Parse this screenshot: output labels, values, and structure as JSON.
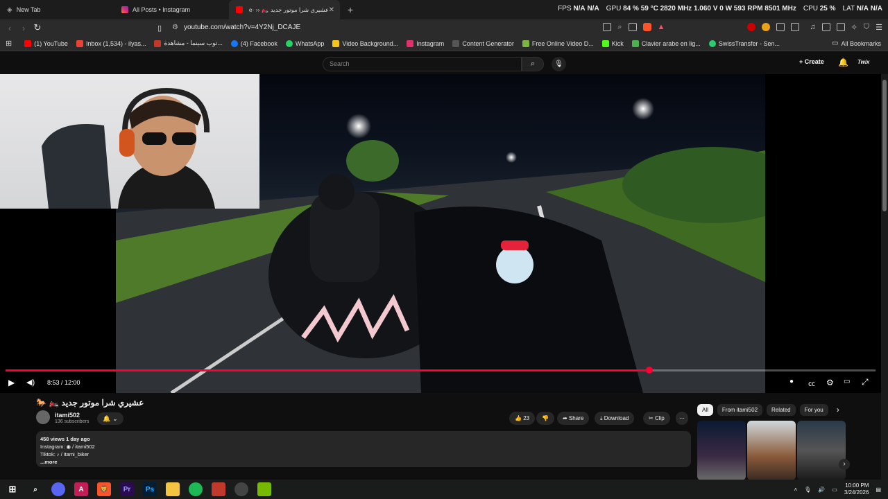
{
  "tabs": [
    {
      "title": "New Tab",
      "icon": "new-tab-icon"
    },
    {
      "title": "All Posts • Instagram",
      "icon": "instagram-icon"
    },
    {
      "title": "عشيري شرا موتور جديد 🏍️ ‹‹ ·e",
      "icon": "youtube-icon",
      "active": true
    }
  ],
  "hud": {
    "fps_label": "FPS",
    "fps1": "N/A",
    "fps2": "N/A",
    "gpu_label": "GPU",
    "gpu_load": "84 %",
    "gpu_temp": "59 °C",
    "gpu_clock": "2820 MHz",
    "gpu_volt": "1.060 V",
    "gpu_power": "0 W",
    "gpu_fan": "593 RPM",
    "gpu_mem": "8501 MHz",
    "cpu_label": "CPU",
    "cpu_load": "25 %",
    "lat_label": "LAT",
    "lat1": "N/A",
    "lat2": "N/A"
  },
  "address": {
    "url": "youtube.com/watch?v=4Y2Nj_DCAJE"
  },
  "bookmarks": [
    {
      "label": "(1) YouTube",
      "color": "#ff0000"
    },
    {
      "label": "Inbox (1,534) - ilyas...",
      "color": "#ea4335"
    },
    {
      "label": "توب سينما - مشاهدة...",
      "color": "#c0392b"
    },
    {
      "label": "(4) Facebook",
      "color": "#1877f2"
    },
    {
      "label": "WhatsApp",
      "color": "#25d366"
    },
    {
      "label": "Video Background...",
      "color": "#f5c518"
    },
    {
      "label": "Instagram",
      "color": "#e1306c"
    },
    {
      "label": "Content Generator",
      "color": "#555555"
    },
    {
      "label": "Free Online Video D...",
      "color": "#7cb342"
    },
    {
      "label": "Kick",
      "color": "#53fc18"
    },
    {
      "label": "Clavier arabe en lig...",
      "color": "#4caf50"
    },
    {
      "label": "SwissTransfer - Sen...",
      "color": "#2ecc71"
    }
  ],
  "all_bookmarks": "All Bookmarks",
  "yt": {
    "search_placeholder": "Search",
    "create": "Create",
    "account": "Twix"
  },
  "player": {
    "time": "8:53 / 12:00",
    "progress": 0.74
  },
  "video": {
    "title": "عشيري شرا موتور جديد 🏍️ 🐎",
    "channel": "itami502",
    "subscribers": "136 subscribers",
    "likes": "23",
    "share": "Share",
    "download": "Download",
    "clip": "Clip",
    "description": {
      "line1": "458 views  1 day ago",
      "line2": "Instagram:  ◉ / itami502",
      "line3": "Tiktok:   ♪ / itami_biker",
      "more": "...more"
    }
  },
  "chips": [
    "All",
    "From itami502",
    "Related",
    "For you"
  ],
  "taskbar": {
    "time": "10:00 PM",
    "date": "3/24/2026"
  }
}
